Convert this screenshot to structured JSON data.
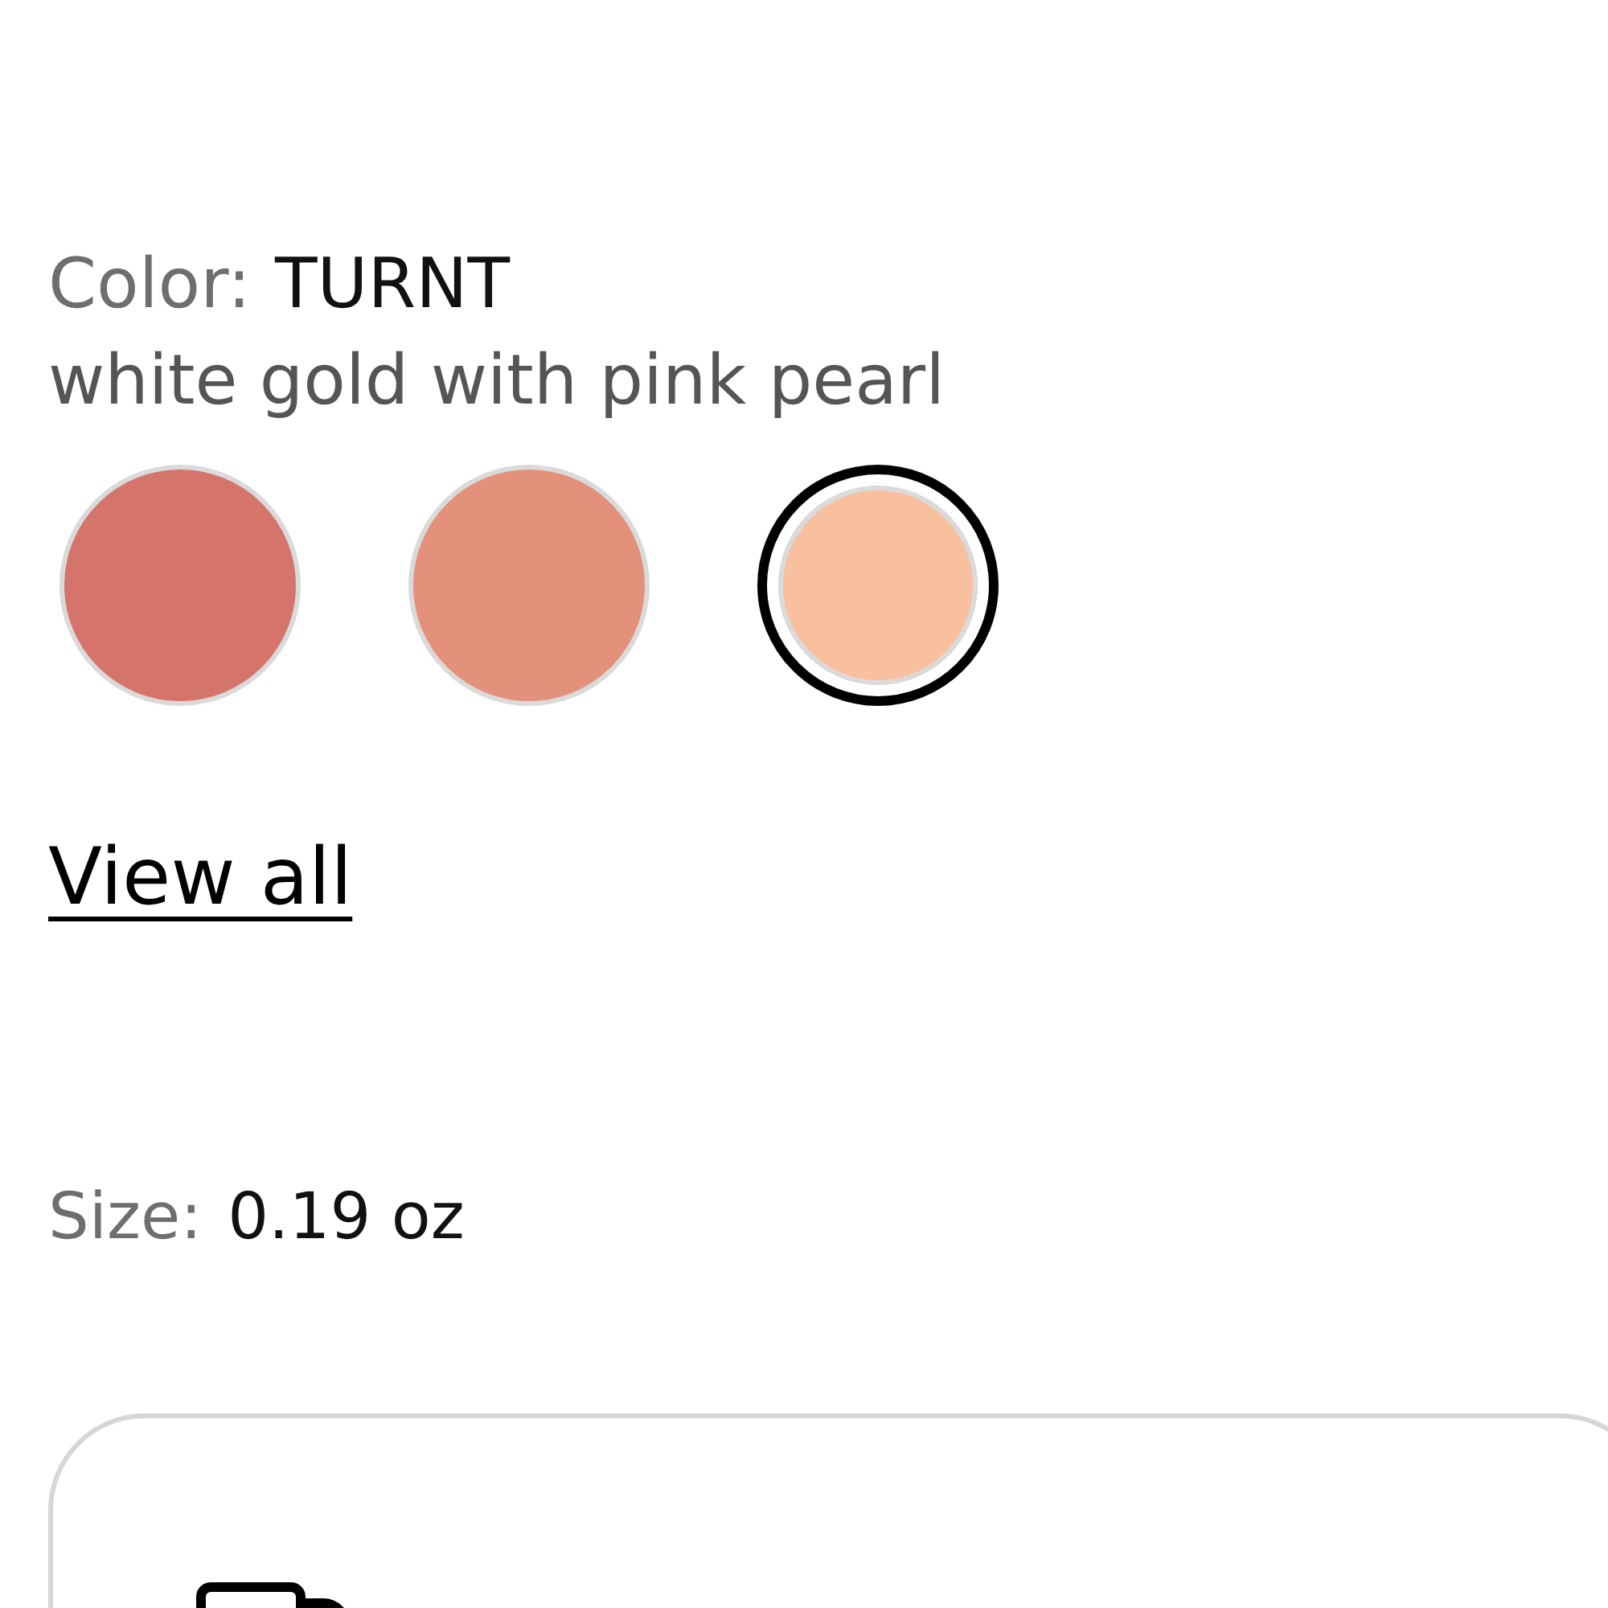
{
  "color_selector": {
    "label": "Color:",
    "value": "TURNT",
    "description": "white gold with pink pearl",
    "swatches": [
      {
        "color": "#d4746a",
        "selected": false
      },
      {
        "color": "#e3917a",
        "selected": false
      },
      {
        "color": "#f9c0a0",
        "selected": true
      }
    ],
    "view_all_link": "View all"
  },
  "size_selector": {
    "label": "Size:",
    "value": "0.19 oz"
  }
}
